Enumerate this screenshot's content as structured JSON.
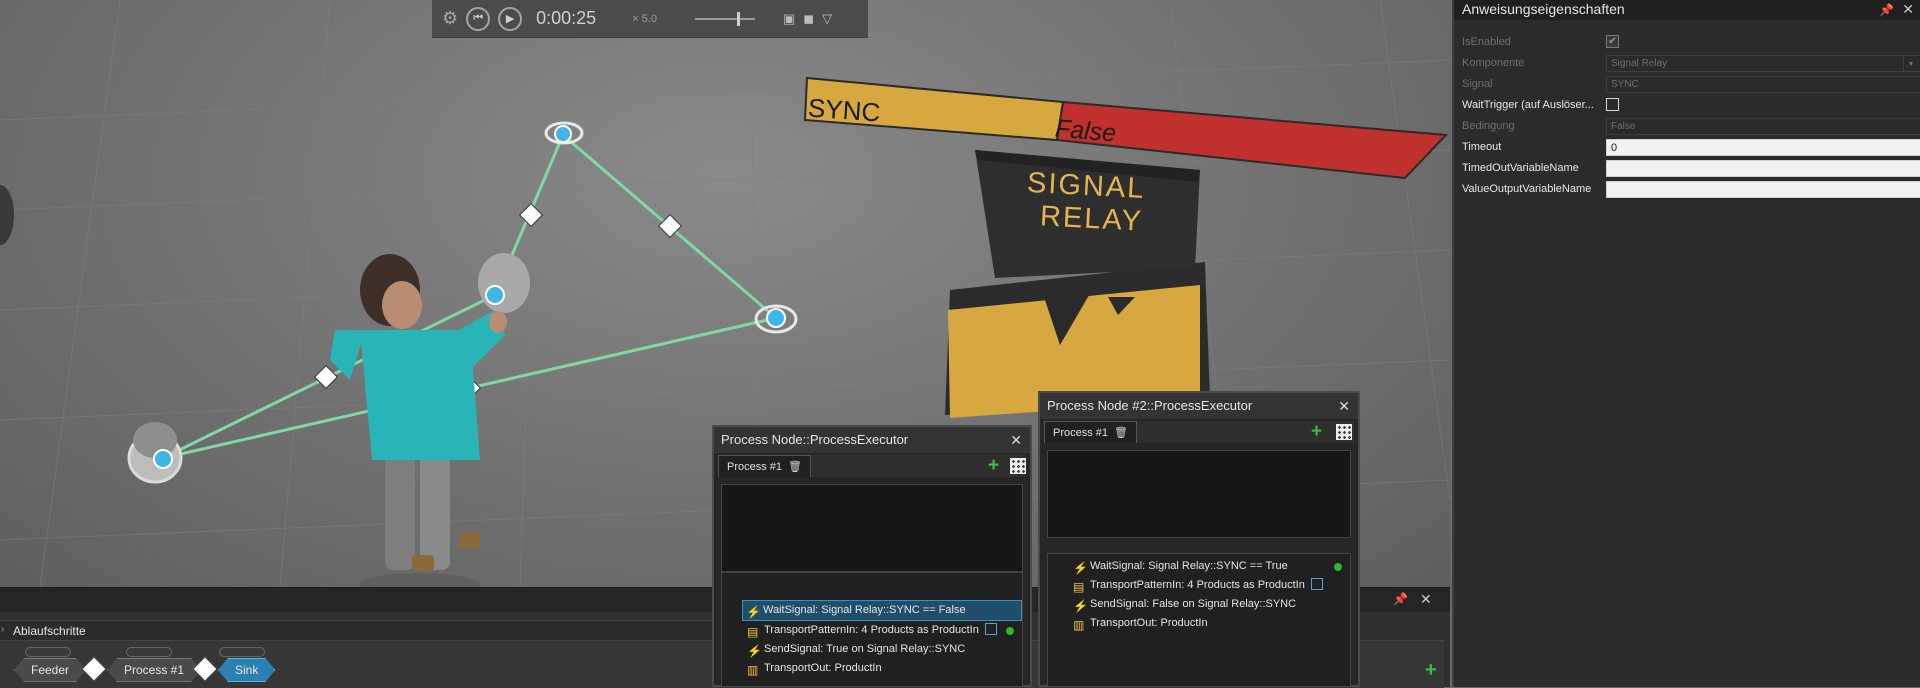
{
  "playbar": {
    "time": "0:00:25",
    "speed": "× 5.0"
  },
  "scene": {
    "banner_left": "SYNC",
    "banner_right": "False",
    "relay_line1": "SIGNAL",
    "relay_line2": "RELAY"
  },
  "properties": {
    "title": "Anweisungseigenschaften",
    "rows": [
      {
        "label": "IsEnabled",
        "type": "checkbox",
        "checked": true,
        "active": false
      },
      {
        "label": "Komponente",
        "type": "dropdown",
        "value": "Signal Relay",
        "active": false
      },
      {
        "label": "Signal",
        "type": "text",
        "value": "SYNC",
        "active": false
      },
      {
        "label": "WaitTrigger (auf Auslöser...",
        "type": "checkbox",
        "checked": false,
        "active": true
      },
      {
        "label": "Bedingung",
        "type": "text",
        "value": "False",
        "active": false
      },
      {
        "label": "Timeout",
        "type": "white",
        "value": "0",
        "active": true
      },
      {
        "label": "TimedOutVariableName",
        "type": "white",
        "value": "",
        "active": true
      },
      {
        "label": "ValueOutputVariableName",
        "type": "white",
        "value": "",
        "active": true
      }
    ]
  },
  "sequence": {
    "title": "Ablaufschritte",
    "steps": [
      "Feeder",
      "Process #1",
      "Sink"
    ]
  },
  "executor1": {
    "title": "Process Node::ProcessExecutor",
    "tab": "Process #1",
    "items": [
      {
        "icon": "wait-signal",
        "text": "WaitSignal: Signal Relay::SYNC == False",
        "selected": true
      },
      {
        "icon": "transport-pattern",
        "text": "TransportPatternIn: 4 Products as ProductIn",
        "checkbox": true,
        "dot": true
      },
      {
        "icon": "send-signal",
        "text": "SendSignal: True on Signal Relay::SYNC"
      },
      {
        "icon": "transport-out",
        "text": "TransportOut: ProductIn"
      }
    ]
  },
  "executor2": {
    "title": "Process Node #2::ProcessExecutor",
    "tab": "Process #1",
    "items": [
      {
        "icon": "wait-signal",
        "text": "WaitSignal: Signal Relay::SYNC == True",
        "dot": true
      },
      {
        "icon": "transport-pattern",
        "text": "TransportPatternIn: 4 Products as ProductIn",
        "checkbox": true
      },
      {
        "icon": "send-signal",
        "text": "SendSignal: False on Signal Relay::SYNC"
      },
      {
        "icon": "transport-out",
        "text": "TransportOut: ProductIn"
      }
    ]
  },
  "colors": {
    "accent_green": "#3fbf3f",
    "selection_blue": "#2a80b0",
    "banner_yellow": "#d8a840",
    "banner_red": "#c0302c",
    "path_green": "#7fd9a0",
    "node_blue": "#3fb6e6"
  }
}
